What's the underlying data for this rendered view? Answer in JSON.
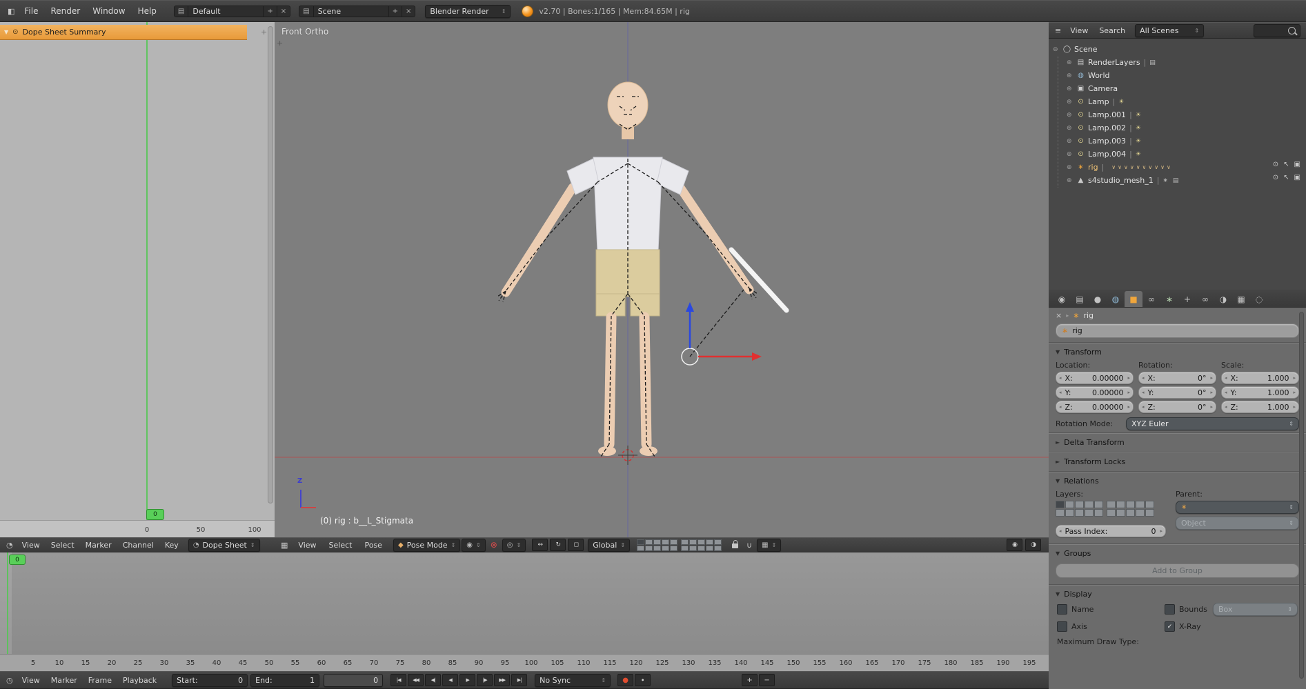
{
  "colors": {
    "accent_orange": "#f0a63c",
    "frame_green": "#59cf59",
    "selected_text": "#f3c577",
    "axis_red": "#cc3b3b",
    "axis_blue": "#3c3cd0",
    "header_bg": "#3d3d3d",
    "viewport_bg": "#7e7e7e"
  },
  "ui": {
    "stepper_left": "◂",
    "stepper_right": "▸",
    "dropdown_arrows": "⇕",
    "menu_arrow": "▾",
    "collapse_open": "▼",
    "collapse_closed": "►",
    "check": "✓",
    "sep": "|",
    "plus": "+"
  },
  "infobar": {
    "editor_icon": "◧",
    "menus": [
      "File",
      "Render",
      "Window",
      "Help"
    ],
    "layout": {
      "browse_icon": "▤",
      "value": "Default",
      "add_icon": "+",
      "close_icon": "×"
    },
    "scene": {
      "browse_icon": "▤",
      "value": "Scene",
      "add_icon": "+",
      "close_icon": "×"
    },
    "engine": {
      "value": "Blender Render"
    },
    "status": "v2.70 | Bones:1/165 | Mem:84.65M | rig"
  },
  "dopesheet": {
    "expand_icon": "▼",
    "summary_icon": "⊙",
    "summary_label": "Dope Sheet Summary",
    "frame_badge": "0",
    "ruler_ticks": [
      "0",
      "50",
      "100"
    ],
    "header": {
      "editor_icon": "◔",
      "menus": [
        "View",
        "Select",
        "Marker",
        "Channel",
        "Key"
      ],
      "mode_icon": "◔",
      "mode": "Dope Sheet"
    }
  },
  "viewport": {
    "view_label": "Front Ortho",
    "active_object_label": "(0) rig : b__L_Stigmata",
    "gizmo_z_label": "Z",
    "header": {
      "editor_icon": "▦",
      "menus": [
        "View",
        "Select",
        "Pose"
      ],
      "mode_icon": "◆",
      "mode": "Pose Mode",
      "shading_icon": "◉",
      "proportional_icon": "⊗",
      "pivot_icon": "◎",
      "manipulators": [
        {
          "name": "manipulator-translate",
          "glyph": "↔"
        },
        {
          "name": "manipulator-rotate",
          "glyph": "↻"
        },
        {
          "name": "manipulator-scale",
          "glyph": "◻"
        }
      ],
      "orientation": "Global",
      "snap_icon": "∪",
      "snap_target_icon": "▦",
      "render_icons": [
        {
          "name": "opengl-render-still",
          "glyph": "◉"
        },
        {
          "name": "opengl-render-anim",
          "glyph": "◑"
        }
      ],
      "layers_a": [
        "on",
        "off",
        "off",
        "off",
        "off",
        "off",
        "off",
        "off",
        "off",
        "off"
      ],
      "layers_b": [
        "off",
        "off",
        "off",
        "off",
        "off",
        "off",
        "off",
        "off",
        "off",
        "off"
      ]
    }
  },
  "timeline": {
    "frame_badge": "0",
    "ticks": [
      "5",
      "10",
      "15",
      "20",
      "25",
      "30",
      "35",
      "40",
      "45",
      "50",
      "55",
      "60",
      "65",
      "70",
      "75",
      "80",
      "85",
      "90",
      "95",
      "100",
      "105",
      "110",
      "115",
      "120",
      "125",
      "130",
      "135",
      "140",
      "145",
      "150",
      "155",
      "160",
      "165",
      "170",
      "175",
      "180",
      "185",
      "190",
      "195"
    ],
    "header": {
      "editor_icon": "◷",
      "menus": [
        "View",
        "Marker",
        "Frame",
        "Playback"
      ],
      "start_label": "Start:",
      "start_value": "0",
      "end_label": "End:",
      "end_value": "1",
      "frame_value": "0",
      "playback": [
        {
          "name": "jump-to-start",
          "glyph": "|◀"
        },
        {
          "name": "jump-to-prev-keyframe",
          "glyph": "◀◀"
        },
        {
          "name": "frame-back",
          "glyph": "◀|"
        },
        {
          "name": "play-reverse",
          "glyph": "◀"
        },
        {
          "name": "play",
          "glyph": "▶"
        },
        {
          "name": "frame-forward",
          "glyph": "|▶"
        },
        {
          "name": "jump-to-next-keyframe",
          "glyph": "▶▶"
        },
        {
          "name": "jump-to-end",
          "glyph": "▶|"
        }
      ],
      "sync": "No Sync",
      "record_icon": "●",
      "keying_icon": "∙",
      "extra_icons": [
        {
          "name": "insert-keyframe",
          "glyph": "+"
        },
        {
          "name": "delete-keyframe",
          "glyph": "−"
        }
      ]
    }
  },
  "outliner": {
    "header": {
      "editor_icon": "≡",
      "menus": [
        "View",
        "Search"
      ],
      "filter": "All Scenes"
    },
    "restrict": {
      "hide": "⊙",
      "select": "↖",
      "render": "▣"
    },
    "items": [
      {
        "label": "Scene",
        "glyph": "◯",
        "expand": "⊖"
      },
      {
        "label": "RenderLayers",
        "glyph": "▤",
        "expand": "⊕",
        "trailing": "▤"
      },
      {
        "label": "World",
        "glyph": "◍",
        "expand": "⊕"
      },
      {
        "label": "Camera",
        "glyph": "▣",
        "expand": "⊕"
      },
      {
        "label": "Lamp",
        "glyph": "⊙",
        "expand": "⊕",
        "trailing": "☀"
      },
      {
        "label": "Lamp.001",
        "glyph": "⊙",
        "expand": "⊕",
        "trailing": "☀"
      },
      {
        "label": "Lamp.002",
        "glyph": "⊙",
        "expand": "⊕",
        "trailing": "☀"
      },
      {
        "label": "Lamp.003",
        "glyph": "⊙",
        "expand": "⊕",
        "trailing": "☀"
      },
      {
        "label": "Lamp.004",
        "glyph": "⊙",
        "expand": "⊕",
        "trailing": "☀"
      },
      {
        "label": "rig",
        "glyph": "∗",
        "expand": "⊕",
        "badges": "∨∨∨∨∨∨∨∨∨∨"
      },
      {
        "label": "s4studio_mesh_1",
        "glyph": "▲",
        "expand": "⊕",
        "badges": "∗ ▤"
      }
    ]
  },
  "properties": {
    "tabs": [
      {
        "name": "render",
        "glyph": "◉"
      },
      {
        "name": "render-layers",
        "glyph": "▤"
      },
      {
        "name": "scene",
        "glyph": "●"
      },
      {
        "name": "world",
        "glyph": "◍"
      },
      {
        "name": "object",
        "glyph": "■",
        "active": true
      },
      {
        "name": "constraints",
        "glyph": "∞"
      },
      {
        "name": "armature-data",
        "glyph": "∗"
      },
      {
        "name": "bone",
        "glyph": "+"
      },
      {
        "name": "bone-constraints",
        "glyph": "∞"
      },
      {
        "name": "material",
        "glyph": "◑"
      },
      {
        "name": "texture",
        "glyph": "▦"
      },
      {
        "name": "physics",
        "glyph": "◌"
      }
    ],
    "breadcrumb": {
      "tool_icon": "×",
      "arrow": "▸",
      "object_icon": "∗",
      "label": "rig"
    },
    "name_field": {
      "icon": "∗",
      "value": "rig"
    },
    "transform": {
      "title": "Transform",
      "col_labels": [
        "Location:",
        "Rotation:",
        "Scale:"
      ],
      "location": [
        {
          "axis": "X:",
          "value": "0.00000"
        },
        {
          "axis": "Y:",
          "value": "0.00000"
        },
        {
          "axis": "Z:",
          "value": "0.00000"
        }
      ],
      "rotation": [
        {
          "axis": "X:",
          "value": "0°"
        },
        {
          "axis": "Y:",
          "value": "0°"
        },
        {
          "axis": "Z:",
          "value": "0°"
        }
      ],
      "scale": [
        {
          "axis": "X:",
          "value": "1.000"
        },
        {
          "axis": "Y:",
          "value": "1.000"
        },
        {
          "axis": "Z:",
          "value": "1.000"
        }
      ],
      "rotation_mode_label": "Rotation Mode:",
      "rotation_mode": "XYZ Euler"
    },
    "panels": {
      "delta": "Delta Transform",
      "locks": "Transform Locks",
      "relations": "Relations",
      "groups": "Groups",
      "display": "Display"
    },
    "relations": {
      "layers_label": "Layers:",
      "layers_a": [
        "on",
        "off",
        "off",
        "off",
        "off",
        "off",
        "off",
        "off",
        "off",
        "off"
      ],
      "layers_b": [
        "off",
        "off",
        "off",
        "off",
        "off",
        "off",
        "off",
        "off",
        "off",
        "off"
      ],
      "parent_label": "Parent:",
      "parent_icon": "∗",
      "object_dropdown": "Object",
      "pass_index_label": "Pass Index:",
      "pass_index_value": "0"
    },
    "groups": {
      "add_button": "Add to Group"
    },
    "display": {
      "name_label": "Name",
      "axis_label": "Axis",
      "bounds_label": "Bounds",
      "bounds_value": "Box",
      "xray_label": "X-Ray",
      "max_draw_label": "Maximum Draw Type:"
    }
  }
}
